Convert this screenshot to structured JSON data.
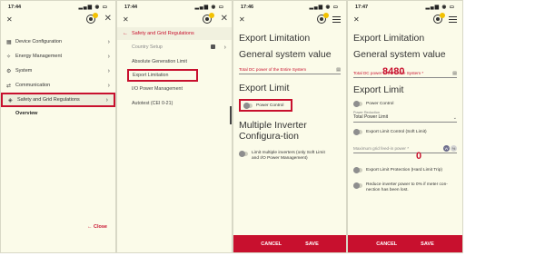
{
  "screen1": {
    "status": {
      "time": "17:44",
      "signal": "▂▄▆ ◉ ▭"
    },
    "nav": [
      {
        "icon": "grid-icon",
        "glyph": "▦",
        "label": "Device Configuration"
      },
      {
        "icon": "energy-icon",
        "glyph": "✧",
        "label": "Energy Management"
      },
      {
        "icon": "gear-icon",
        "glyph": "⚙",
        "label": "System"
      },
      {
        "icon": "arrows-icon",
        "glyph": "⇄",
        "label": "Communication"
      },
      {
        "icon": "shield-icon",
        "glyph": "◈",
        "label": "Safety and Grid Regulations"
      }
    ],
    "sub_item": "Overview",
    "close_label": "Close",
    "close_glyph": "←"
  },
  "screen2": {
    "status": {
      "time": "17:44",
      "signal": "▂▄▆ ◉ ▭"
    },
    "header": "Safety and Grid Regulations",
    "header_glyph": "←",
    "rows": [
      "Country Setup",
      "Absolute Generation Limit",
      "Export Limitation",
      "I/O Power Management",
      "Autotest (CEI 0-21)"
    ]
  },
  "screen3": {
    "status": {
      "time": "17:46",
      "signal": "▂▄▆ ◉ ▭"
    },
    "title": "Export Limitation",
    "section1": "General system value",
    "total_dc_label": "Total DC power of the Entire System",
    "section2": "Export Limit",
    "power_control": "Power Control",
    "section3": "Multiple Inverter Configura-tion",
    "limit_multiple": "Limit multiple inverters (only Soft Limit and I/O Power Management)",
    "cancel": "CANCEL",
    "save": "SAVE"
  },
  "screen4": {
    "status": {
      "time": "17:47",
      "signal": "▂▄▆ ◉ ▭"
    },
    "title": "Export Limitation",
    "section1": "General system value",
    "total_dc_value": "8480",
    "total_dc_label": "Total DC power of the Entire System *",
    "section2": "Export Limit",
    "power_control": "Power Control",
    "power_reduction_label": "Power Reduction",
    "power_reduction_value": "Total Power Limit",
    "export_soft": "Export Limit Control (Soft Limit)",
    "max_grid_label": "Maximum grid feed-in power *",
    "max_grid_value": "0",
    "unit_w": "W",
    "unit_pct": "%",
    "export_hard": "Export Limit Protection (Hard Limit Trip)",
    "reduce_power": "Reduce inverter power to 0% if meter con-nection has been lost.",
    "cancel": "CANCEL",
    "save": "SAVE"
  },
  "colors": {
    "accent": "#c8102e",
    "background": "#fbfbe9",
    "badge": "#f2c100"
  }
}
